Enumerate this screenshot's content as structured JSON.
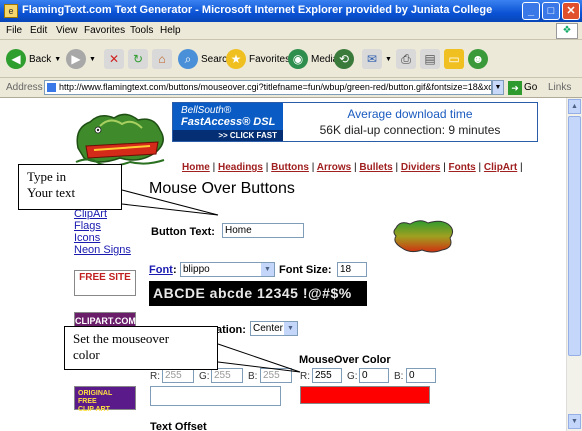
{
  "window": {
    "title": "FlamingText.com Text Generator - Microsoft Internet Explorer provided by Juniata College",
    "controls": [
      "minimize",
      "maximize",
      "close"
    ]
  },
  "menu": {
    "items": [
      "File",
      "Edit",
      "View",
      "Favorites",
      "Tools",
      "Help"
    ]
  },
  "toolbar": {
    "back_label": "Back",
    "search_label": "Search",
    "favorites_label": "Favorites",
    "media_label": "Media"
  },
  "address": {
    "label": "Address",
    "url": "http://www.flamingtext.com/buttons/mouseover.cgi?titlefname=fun/wbup/green-red/button.gif&fontsize=18&xoff=0&yoff=",
    "go_label": "Go",
    "links_label": "Links"
  },
  "banner": {
    "brand": "BellSouth®",
    "product": "FastAccess® DSL",
    "cta": ">> CLICK FAST",
    "line1": "Average download time",
    "line2": "56K dial-up connection: 9 minutes"
  },
  "nav": {
    "links": [
      "Home",
      "Headings",
      "Buttons",
      "Arrows",
      "Bullets",
      "Dividers",
      "Fonts",
      "ClipArt"
    ],
    "separator": "|"
  },
  "page": {
    "title": "Mouse Over Buttons"
  },
  "sidebar": {
    "links": [
      "ClipArt",
      "Flags",
      "Icons",
      "Neon Signs"
    ],
    "ads": [
      "FREE SITE",
      "CLIPART.COM",
      "ORIGINAL FREE CLIP ART"
    ]
  },
  "form": {
    "button_text_label": "Button Text:",
    "button_text_value": "Home",
    "font_label": "Font",
    "font_value": "blippo",
    "font_size_label": "Font Size:",
    "font_size_value": "18",
    "font_preview": "ABCDE abcde 12345 !@#$%",
    "orientation_label": "ation:",
    "orientation_value": "Center",
    "mouseover_color_label": "MouseOver Color",
    "left_r_label": "R:",
    "left_r_value": "255",
    "left_g_label": "G:",
    "left_g_value": "255",
    "left_b_label": "B:",
    "left_b_value": "255",
    "right_r_label": "R:",
    "right_r_value": "255",
    "right_g_label": "G:",
    "right_g_value": "0",
    "right_b_label": "B:",
    "right_b_value": "0",
    "text_offset_label": "Text Offset"
  },
  "callouts": {
    "type_in": "Type in\nYour text",
    "mouseover": "Set the mouseover\ncolor"
  },
  "colors": {
    "mouseover_swatch": "#ff0000",
    "link_color": "#a02020",
    "title_bar": "#0a52d4"
  }
}
